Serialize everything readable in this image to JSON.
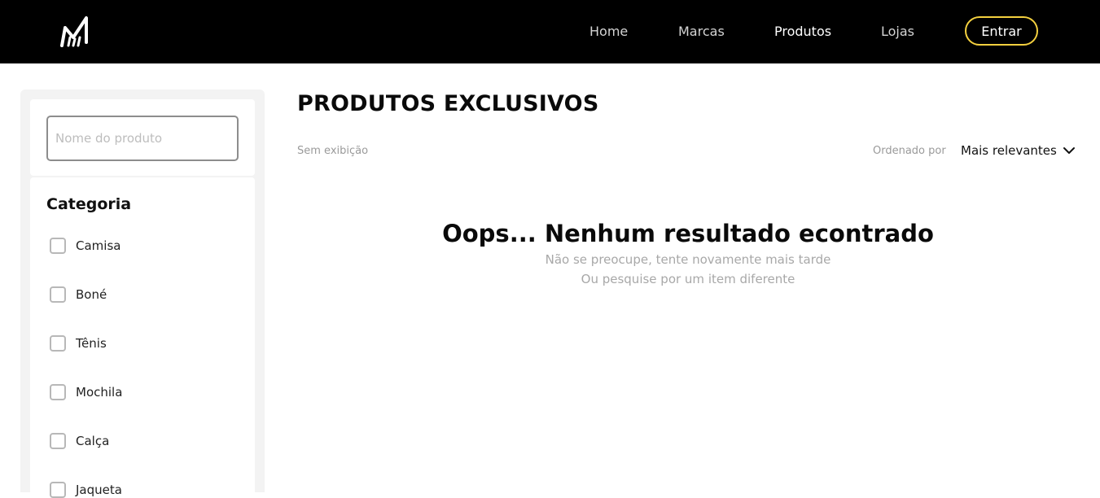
{
  "header": {
    "nav": [
      {
        "label": "Home"
      },
      {
        "label": "Marcas"
      },
      {
        "label": "Produtos"
      },
      {
        "label": "Lojas"
      }
    ],
    "login_label": "Entrar",
    "accent_color": "#f4d03f",
    "background_color": "#000000"
  },
  "sidebar": {
    "search": {
      "placeholder": "Nome do produto",
      "value": ""
    },
    "category_title": "Categoria",
    "categories": [
      {
        "label": "Camisa",
        "checked": false
      },
      {
        "label": "Boné",
        "checked": false
      },
      {
        "label": "Tênis",
        "checked": false
      },
      {
        "label": "Mochila",
        "checked": false
      },
      {
        "label": "Calça",
        "checked": false
      },
      {
        "label": "Jaqueta",
        "checked": false
      }
    ]
  },
  "main": {
    "title": "PRODUTOS EXCLUSIVOS",
    "display_status": "Sem exibição",
    "sort_label": "Ordenado por",
    "sort_value": "Mais relevantes",
    "empty": {
      "title": "Oops... Nenhum resultado econtrado",
      "line1": "Não se preocupe, tente novamente mais tarde",
      "line2": "Ou pesquise por um item diferente"
    }
  },
  "icons": {
    "logo": "brand-logo-icon",
    "sort": "chevron-down-icon"
  }
}
